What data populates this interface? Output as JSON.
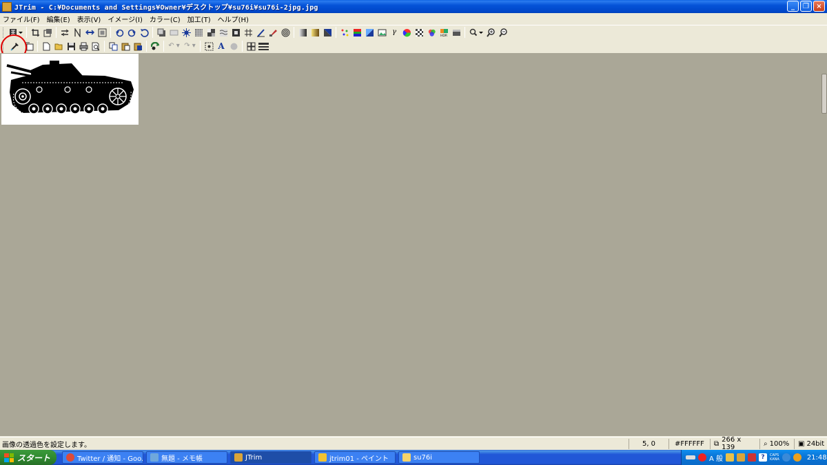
{
  "window": {
    "title": "JTrim - C:¥Documents and Settings¥Owner¥デスクトップ¥su76i¥su76i-2jpg.jpg",
    "minimize": "_",
    "restore": "❐",
    "close": "×"
  },
  "menu": [
    "ファイル(F)",
    "編集(E)",
    "表示(V)",
    "イメージ(I)",
    "カラー(C)",
    "加工(T)",
    "ヘルプ(H)"
  ],
  "toolbar1": [
    "grid-dropdown-icon",
    "crop-icon",
    "resize-icon",
    "flip-horizontal-icon",
    "flip-vertical-icon",
    "shift-icon",
    "frame-icon",
    "rotate-left-icon",
    "rotate-right-icon",
    "rotate-free-icon",
    "shadow-icon",
    "blank-icon",
    "sparkle-icon",
    "mosaic-icon",
    "emboss-icon",
    "wave-icon",
    "spot-icon",
    "tile-icon",
    "pen-icon",
    "brush-icon",
    "spiral-icon",
    "gradient1-icon",
    "gradient2-icon",
    "gradient3-icon",
    "color-noise-icon",
    "rgb-bar-icon",
    "gradient4-icon",
    "photo-icon",
    "gamma-icon",
    "palette-icon",
    "checker-icon",
    "color-balance-icon",
    "hdr-icon",
    "grayscale-icon",
    "zoom-dropdown-icon",
    "zoom-in-icon",
    "zoom-out-icon"
  ],
  "toolbar2": [
    "eyedropper-icon",
    "new-window-icon",
    "new-file-icon",
    "open-icon",
    "save-icon",
    "print-icon",
    "print-preview-icon",
    "copy-icon",
    "paste-icon",
    "paste-special-icon",
    "effect-icon",
    "undo-icon",
    "redo-icon",
    "select-all-icon",
    "text-icon",
    "blur-icon",
    "thumbnail-icon",
    "layout-icon"
  ],
  "status": {
    "message": "画像の透過色を設定します。",
    "value": "5, 0",
    "color": "#FFFFFF",
    "size": "266 x 139",
    "zoom": "100%",
    "depth": "24bit"
  },
  "taskbar": {
    "start": "スタート",
    "tasks": [
      {
        "label": "Twitter / 通知 - Goo...",
        "color": "#dd4b39"
      },
      {
        "label": "無題 - メモ帳",
        "color": "#6fa8dc"
      },
      {
        "label": "JTrim",
        "color": "#d9a43a"
      },
      {
        "label": "jtrim01 - ペイント",
        "color": "#f1c232"
      },
      {
        "label": "su76i",
        "color": "#f6d36b"
      }
    ],
    "ime": "A 般",
    "caps": "CAPS",
    "kana": "KANA",
    "clock": "21:48"
  },
  "colors": {
    "workspace": "#aaa797",
    "highlight_circle": "#e00000"
  }
}
